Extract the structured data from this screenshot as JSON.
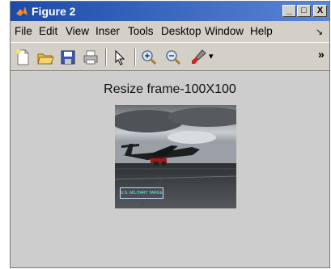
{
  "window": {
    "title": "Figure 2",
    "minimize_label": "_",
    "maximize_label": "□",
    "close_label": "X"
  },
  "menu": {
    "items": [
      "File",
      "Edit",
      "View",
      "Inser",
      "Tools",
      "Desktop",
      "Window",
      "Help"
    ],
    "more_label": "↘"
  },
  "toolbar": {
    "tools": [
      "new-figure",
      "open-file",
      "save",
      "print",
      "select-pointer",
      "zoom-in",
      "zoom-out",
      "brush"
    ],
    "dropdown_label": "▾",
    "overflow_label": "»"
  },
  "figure": {
    "title": "Resize frame-100X100",
    "image_label": "U.S. MILITARY TARGET"
  },
  "colors": {
    "titlebar_start": "#1c4aa8",
    "titlebar_end": "#5a86d6",
    "window_bg": "#d4d0c8",
    "figure_bg": "#cdcdcd",
    "label_text": "#6ff0ff"
  }
}
